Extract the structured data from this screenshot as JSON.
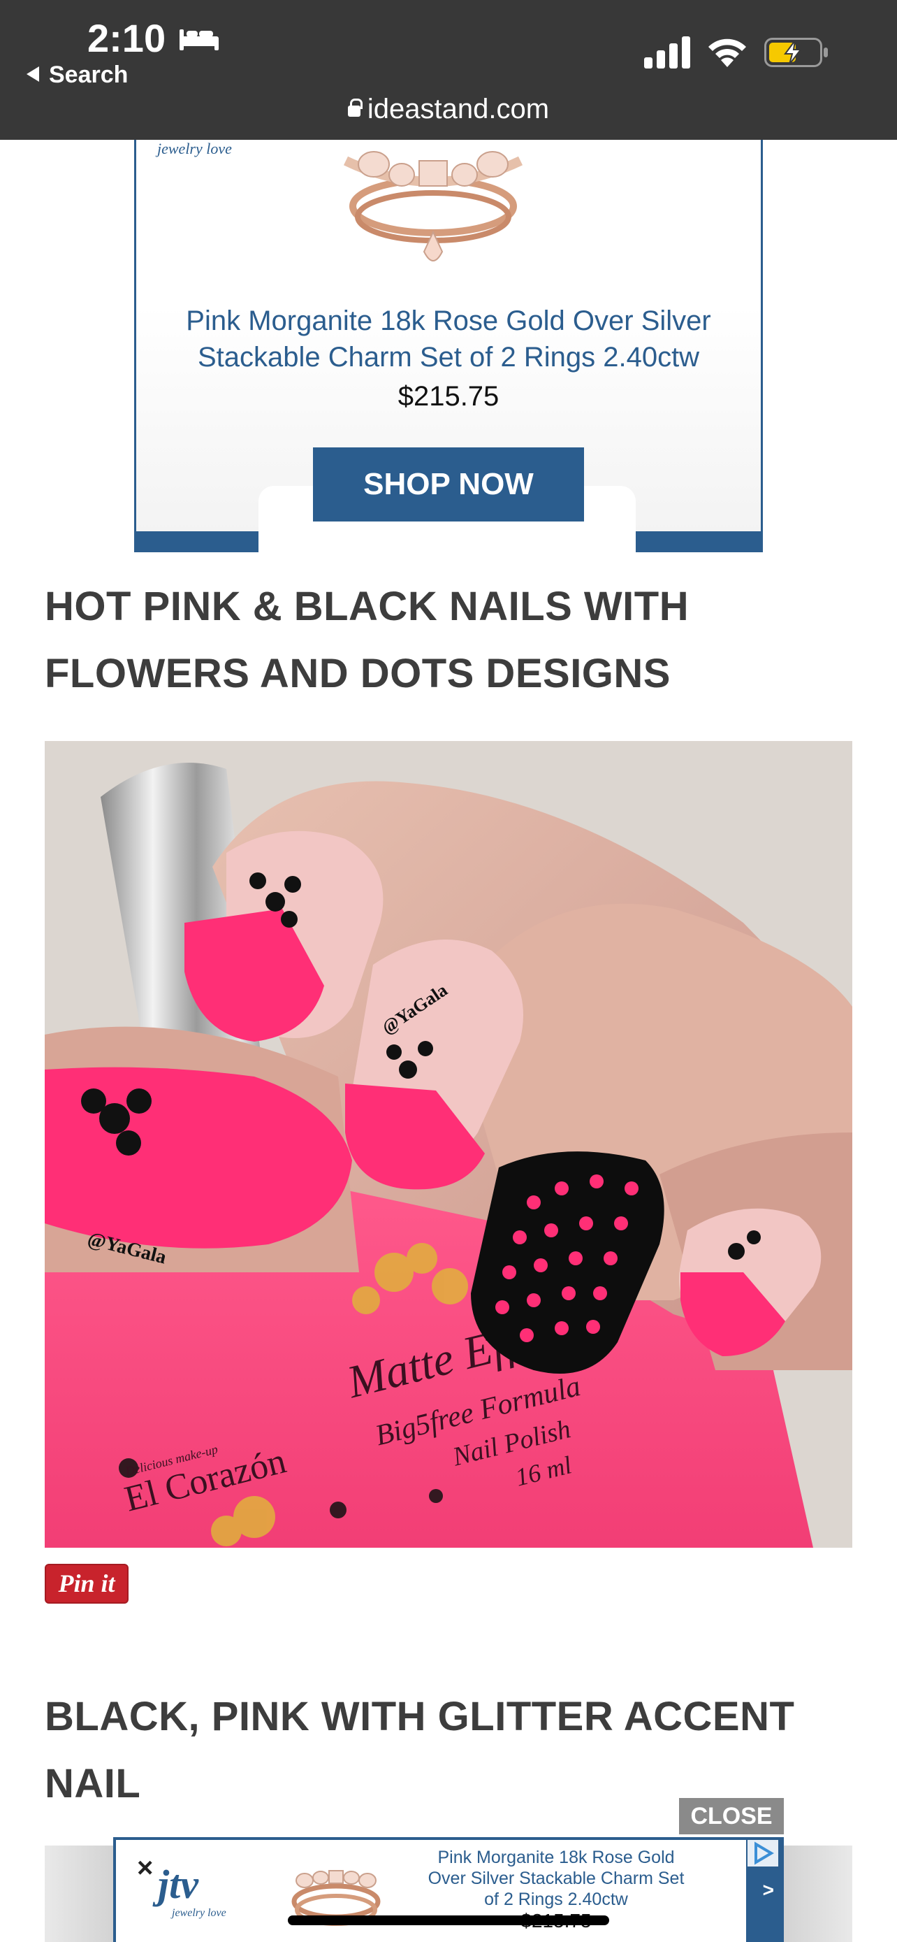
{
  "status": {
    "time": "2:10",
    "back_label": "Search",
    "url": "ideastand.com"
  },
  "top_ad": {
    "logo": "jewelry love",
    "product_title": "Pink Morganite 18k Rose Gold Over Silver Stackable Charm Set of 2 Rings 2.40ctw",
    "price": "$215.75",
    "cta": "SHOP NOW"
  },
  "article": {
    "heading_1": "HOT PINK & BLACK NAILS WITH FLOWERS AND DOTS DESIGNS",
    "pin_label": "Pin it",
    "heading_2": "BLACK, PINK WITH GLITTER ACCENT NAIL",
    "photo_text": {
      "watermark": "@YaGala",
      "brand": "El Corazón",
      "brand_small": "Delicious make-up",
      "product": "Matte Effect",
      "line2": "Big5free Formula",
      "line3": "Nail Polish",
      "line4": "16 ml"
    }
  },
  "bottom_banner": {
    "close_label": "CLOSE",
    "x_label": "×",
    "logo": "jtv",
    "logo_sub": "jewelry love",
    "text": "Pink Morganite 18k Rose Gold Over Silver Stackable Charm Set of 2 Rings 2.40ctw",
    "price": "$215.75",
    "chevron": ">"
  },
  "colors": {
    "statusbar": "#383838",
    "brand_blue": "#2b5d8e",
    "hot_pink": "#fd3f7c",
    "pin_red": "#c8232c"
  }
}
